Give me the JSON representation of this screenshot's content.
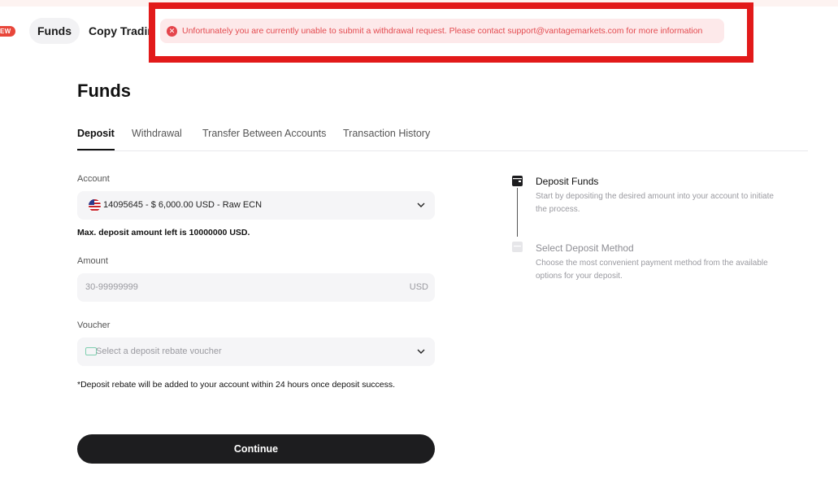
{
  "top_nav": {
    "new_badge": "EW",
    "funds_label": "Funds",
    "copy_trading_label": "Copy Trading"
  },
  "alert": {
    "message": "Unfortunately you are currently unable to submit a withdrawal request. Please contact support@vantagemarkets.com for more information",
    "icon": "close-circle-icon",
    "highlight_color": "#e21a1a"
  },
  "page": {
    "title": "Funds"
  },
  "tabs": [
    {
      "label": "Deposit",
      "active": true
    },
    {
      "label": "Withdrawal",
      "active": false
    },
    {
      "label": "Transfer Between Accounts",
      "active": false
    },
    {
      "label": "Transaction History",
      "active": false
    }
  ],
  "form": {
    "account": {
      "label": "Account",
      "value": "14095645 - $ 6,000.00 USD - Raw ECN",
      "icon": "us-flag-icon"
    },
    "max_deposit_note": "Max. deposit amount left is 10000000 USD.",
    "amount": {
      "label": "Amount",
      "placeholder": "30-99999999",
      "unit": "USD"
    },
    "voucher": {
      "label": "Voucher",
      "placeholder": "Select a deposit rebate voucher",
      "icon": "voucher-icon"
    },
    "rebate_note": "*Deposit rebate will be added to your account within 24 hours once deposit success.",
    "continue_label": "Continue"
  },
  "steps": [
    {
      "title": "Deposit Funds",
      "description": "Start by depositing the desired amount into your account to initiate the process.",
      "icon": "wallet-icon",
      "active": true
    },
    {
      "title": "Select Deposit Method",
      "description": "Choose the most convenient payment method from the available options for your deposit.",
      "icon": "card-icon",
      "active": false
    }
  ]
}
